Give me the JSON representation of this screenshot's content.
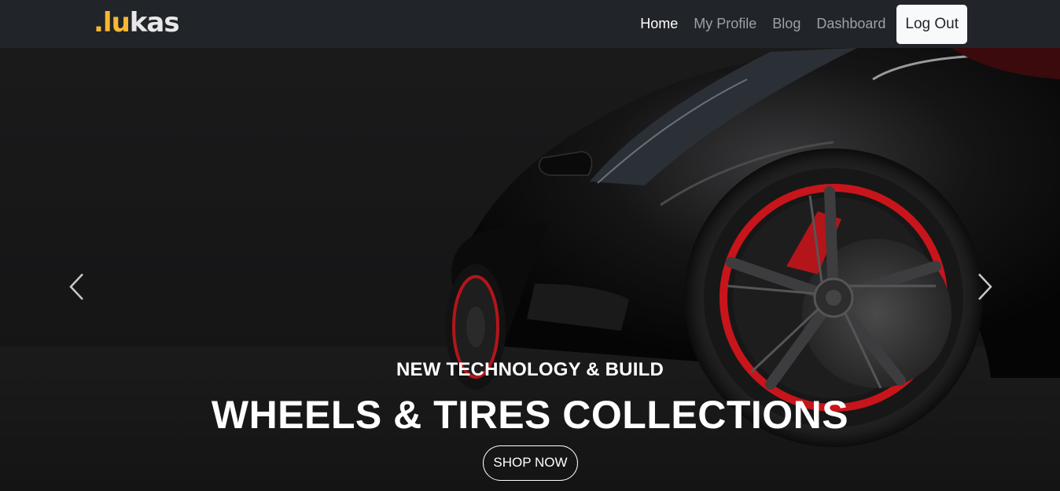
{
  "brand": {
    "accent": ".lu",
    "rest": "kas"
  },
  "nav": {
    "home": "Home",
    "profile": "My Profile",
    "blog": "Blog",
    "dashboard": "Dashboard",
    "logout": "Log Out"
  },
  "hero": {
    "subtitle": "NEW TECHNOLOGY & BUILD",
    "title": "WHEELS & TIRES COLLECTIONS",
    "cta": "SHOP NOW"
  },
  "colors": {
    "navbar": "#212429",
    "brand_accent": "#f7b733",
    "rim_accent": "#c8151b"
  },
  "icons": {
    "prev": "chevron-left-icon",
    "next": "chevron-right-icon"
  }
}
